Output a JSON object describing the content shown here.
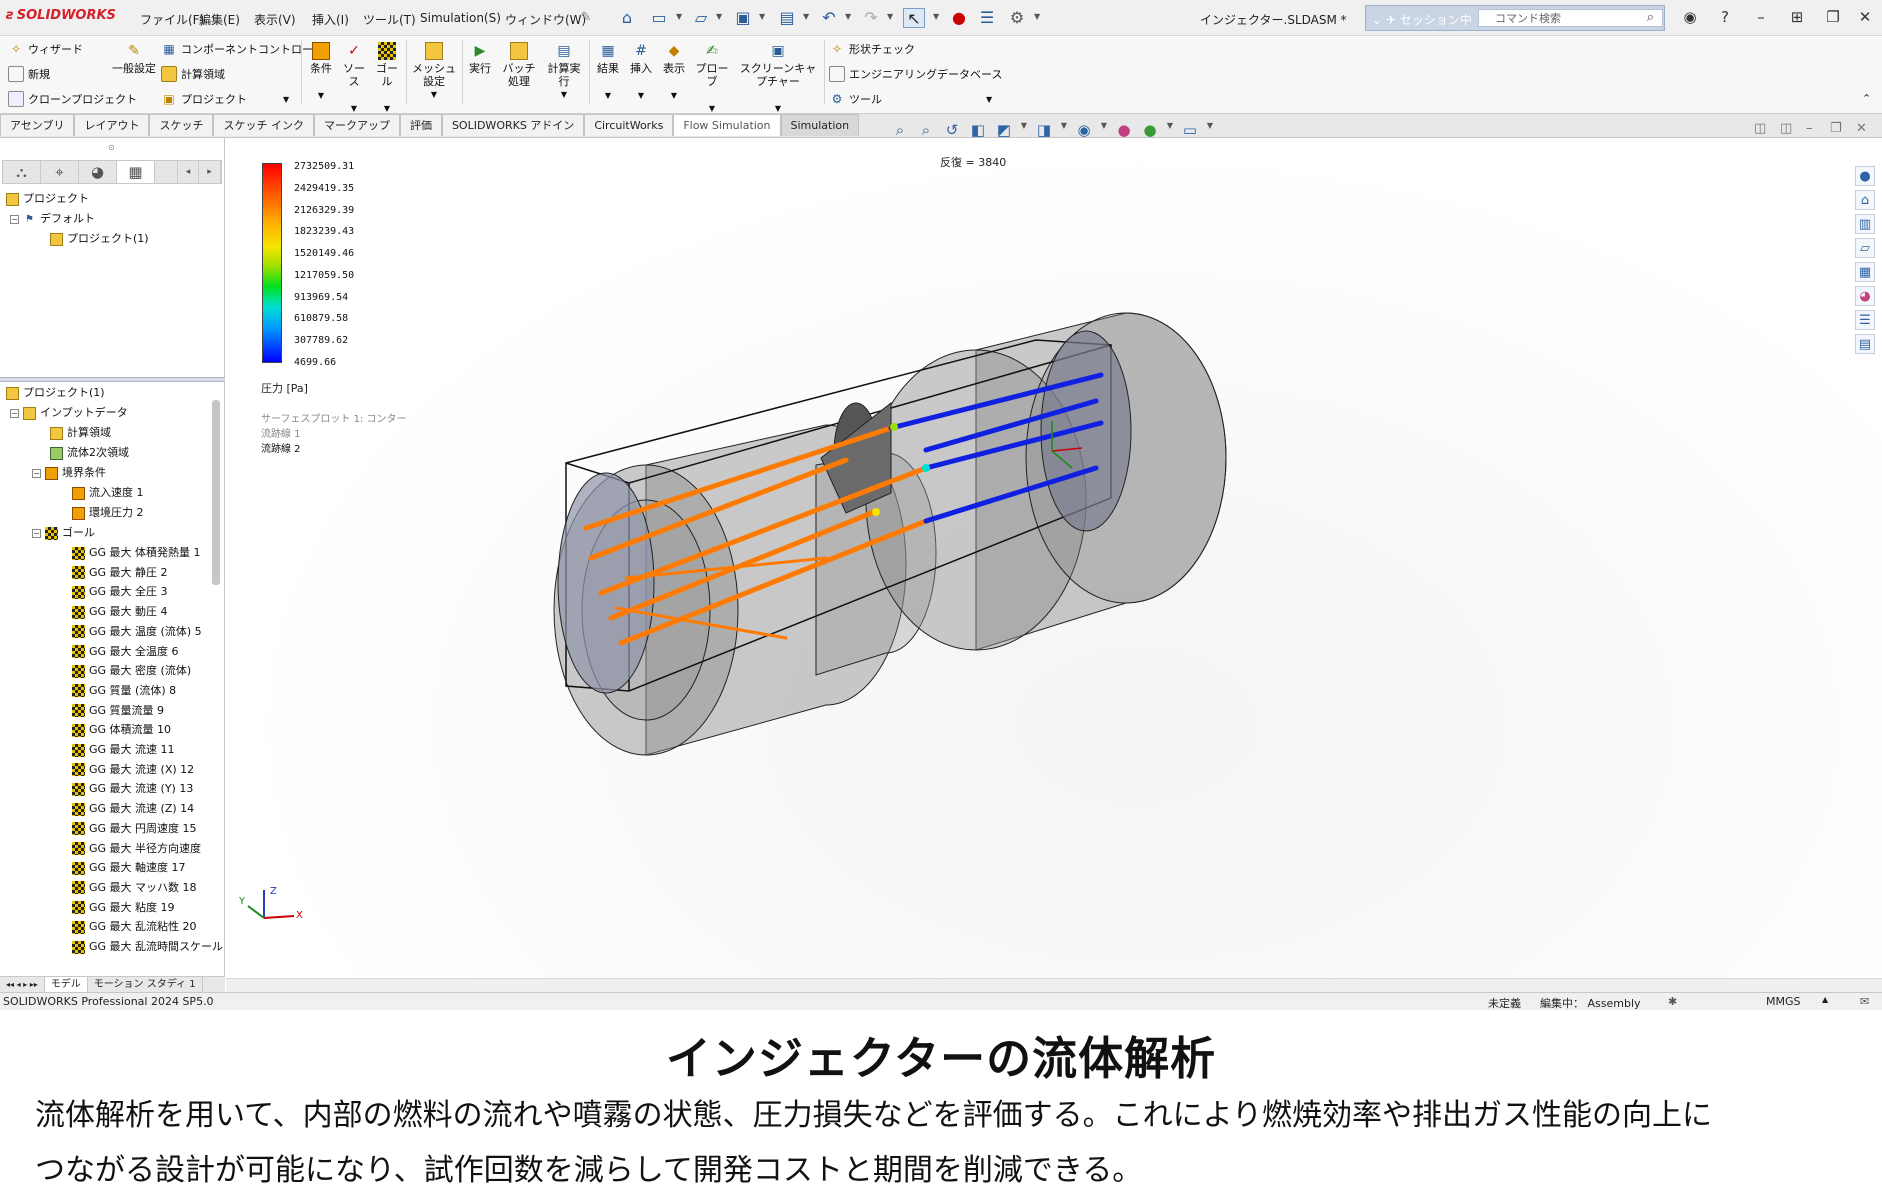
{
  "app": {
    "logo": "SOLIDWORKS",
    "menus": [
      "ファイル(F)",
      "編集(E)",
      "表示(V)",
      "挿入(I)",
      "ツール(T)",
      "Simulation(S)",
      "ウィンドウ(W)"
    ],
    "document_title": "インジェクター.SLDASM *",
    "session_label": "セッション中",
    "search_placeholder": "コマンド検索"
  },
  "ribbon": {
    "col1": [
      "ウィザード",
      "新規",
      "クローンプロジェクト"
    ],
    "general": "一般設定",
    "col3": [
      "コンポーネントコントロール",
      "計算領域",
      "プロジェクト"
    ],
    "group2": [
      "条件",
      "ソース",
      "ゴール"
    ],
    "mesh": "メッシュ設定",
    "group4": [
      "実行",
      "バッチ処理",
      "計算実行"
    ],
    "group5": [
      "結果",
      "挿入",
      "表示",
      "プローブ",
      "スクリーンキャプチャー"
    ],
    "col6": [
      "形状チェック",
      "エンジニアリングデータベース",
      "ツール"
    ]
  },
  "tabs": [
    "アセンブリ",
    "レイアウト",
    "スケッチ",
    "スケッチ インク",
    "マークアップ",
    "評価",
    "SOLIDWORKS アドイン",
    "CircuitWorks",
    "Flow Simulation",
    "Simulation"
  ],
  "active_tab": "Flow Simulation",
  "project_tree_top": {
    "root": "プロジェクト",
    "config": "デフォルト",
    "item": "プロジェクト(1)"
  },
  "feature_tree": {
    "root": "プロジェクト(1)",
    "input": "インプットデータ",
    "domain": "計算領域",
    "subdomain": "流体2次領域",
    "boundary": "境界条件",
    "inlet": "流入速度 1",
    "pressure": "環境圧力 2",
    "goals_label": "ゴール",
    "goals": [
      "GG 最大 体積発熱量 1",
      "GG 最大 静圧 2",
      "GG 最大 全圧 3",
      "GG 最大 動圧 4",
      "GG 最大 温度 (流体) 5",
      "GG 最大 全温度 6",
      "GG 最大 密度 (流体)",
      "GG 質量 (流体) 8",
      "GG 質量流量 9",
      "GG 体積流量 10",
      "GG 最大 流速 11",
      "GG 最大 流速 (X) 12",
      "GG 最大 流速 (Y) 13",
      "GG 最大 流速 (Z) 14",
      "GG 最大 円周速度 15",
      "GG 最大 半径方向速度",
      "GG 最大 軸速度 17",
      "GG 最大 マッハ数 18",
      "GG 最大 粘度 19",
      "GG 最大 乱流粘性 20",
      "GG 最大 乱流時間スケール"
    ]
  },
  "viewport": {
    "iteration": "反復 = 3840",
    "legend_values": [
      "2732509.31",
      "2429419.35",
      "2126329.39",
      "1823239.43",
      "1520149.46",
      "1217059.50",
      "913969.54",
      "610879.58",
      "307789.62",
      "4699.66"
    ],
    "legend_unit": "圧力 [Pa]",
    "plot_labels": [
      "サーフェスプロット 1: コンター",
      "流跡線 1",
      "流跡線 2"
    ],
    "triad": {
      "x": "X",
      "y": "Y",
      "z": "Z"
    }
  },
  "bottom_tabs": [
    "モデル",
    "モーション スタディ 1"
  ],
  "status": {
    "product": "SOLIDWORKS Professional 2024 SP5.0",
    "state": "未定義",
    "editing": "編集中： Assembly",
    "units": "MMGS"
  },
  "caption": {
    "title": "インジェクターの流体解析",
    "line1": "流体解析を用いて、内部の燃料の流れや噴霧の状態、圧力損失などを評価する。これにより燃焼効率や排出ガス性能の向上に",
    "line2": "つながる設計が可能になり、試作回数を減らして開発コストと期間を削減できる。"
  },
  "colors": {
    "accent_red": "#d4202a",
    "orange_trajectory": "#ff7a00",
    "blue_trajectory": "#1020e0",
    "body_gray": "#8c8c8c"
  }
}
